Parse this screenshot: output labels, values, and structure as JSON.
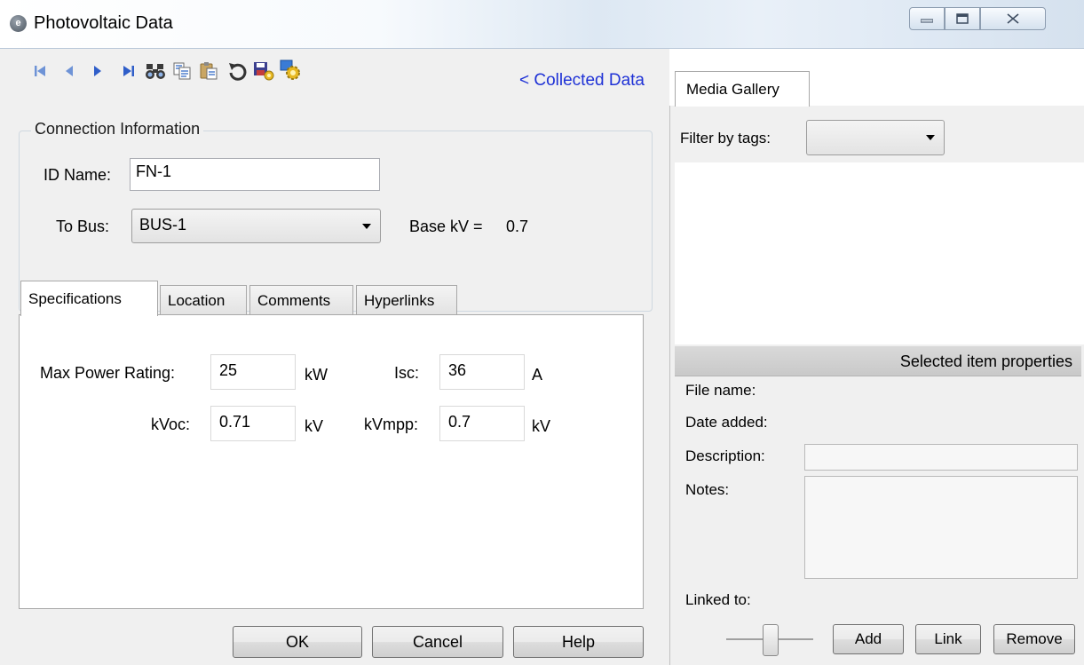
{
  "window": {
    "title": "Photovoltaic Data",
    "app_icon_glyph": "e",
    "controls": {
      "minimize": "minimize-icon",
      "maximize": "maximize-icon",
      "close": "close-icon"
    }
  },
  "toolbar": {
    "icons": [
      "first-record-icon",
      "previous-record-icon",
      "next-record-icon",
      "last-record-icon",
      "find-icon",
      "copy-icon",
      "paste-icon",
      "undo-icon",
      "save-icon",
      "settings-icon"
    ],
    "nav_link": "< Collected Data",
    "accent_color": "#1f32d6"
  },
  "connection": {
    "group_title": "Connection Information",
    "id_name_label": "ID Name:",
    "id_name_value": "FN-1",
    "to_bus_label": "To Bus:",
    "to_bus_value": "BUS-1",
    "base_kv_label": "Base kV =",
    "base_kv_value": "0.7"
  },
  "tabs": [
    {
      "label": "Specifications",
      "active": true
    },
    {
      "label": "Location",
      "active": false
    },
    {
      "label": "Comments",
      "active": false
    },
    {
      "label": "Hyperlinks",
      "active": false
    }
  ],
  "specifications": {
    "max_power_label": "Max Power Rating:",
    "max_power_value": "25",
    "max_power_unit": "kW",
    "isc_label": "Isc:",
    "isc_value": "36",
    "isc_unit": "A",
    "kvoc_label": "kVoc:",
    "kvoc_value": "0.71",
    "kvoc_unit": "kV",
    "kvmpp_label": "kVmpp:",
    "kvmpp_value": "0.7",
    "kvmpp_unit": "kV"
  },
  "buttons": {
    "ok": "OK",
    "cancel": "Cancel",
    "help": "Help"
  },
  "media": {
    "tab_label": "Media Gallery",
    "filter_label": "Filter by tags:",
    "filter_value": "",
    "props_header": "Selected item properties",
    "file_name_label": "File name:",
    "date_added_label": "Date added:",
    "description_label": "Description:",
    "notes_label": "Notes:",
    "linked_to_label": "Linked to:",
    "add_button": "Add",
    "link_button": "Link",
    "remove_button": "Remove"
  }
}
